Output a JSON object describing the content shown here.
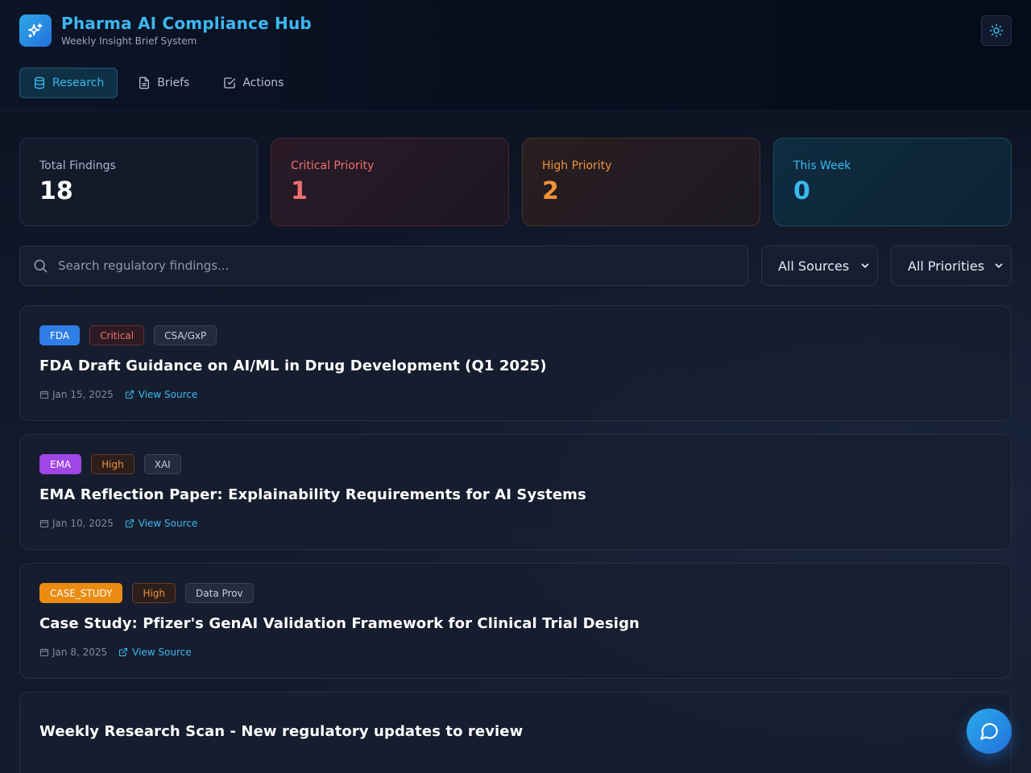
{
  "header": {
    "title": "Pharma AI Compliance Hub",
    "subtitle": "Weekly Insight Brief System",
    "logo_icon": "sparkles-icon",
    "theme_icon": "sun-icon"
  },
  "nav": {
    "items": [
      {
        "label": "Research",
        "icon": "database-icon",
        "active": true
      },
      {
        "label": "Briefs",
        "icon": "document-icon",
        "active": false
      },
      {
        "label": "Actions",
        "icon": "checkbox-icon",
        "active": false
      }
    ]
  },
  "stats": [
    {
      "label": "Total Findings",
      "value": "18"
    },
    {
      "label": "Critical Priority",
      "value": "1"
    },
    {
      "label": "High Priority",
      "value": "2"
    },
    {
      "label": "This Week",
      "value": "0"
    }
  ],
  "filters": {
    "search_placeholder": "Search regulatory findings...",
    "search_value": "",
    "source_selected": "All Sources",
    "priority_selected": "All Priorities"
  },
  "findings": [
    {
      "source": "FDA",
      "priority": "Critical",
      "category": "CSA/GxP",
      "title": "FDA Draft Guidance on AI/ML in Drug Development (Q1 2025)",
      "date": "Jan 15, 2025",
      "link_label": "View Source"
    },
    {
      "source": "EMA",
      "priority": "High",
      "category": "XAI",
      "title": "EMA Reflection Paper: Explainability Requirements for AI Systems",
      "date": "Jan 10, 2025",
      "link_label": "View Source"
    },
    {
      "source": "CASE_STUDY",
      "priority": "High",
      "category": "Data Prov",
      "title": "Case Study: Pfizer's GenAI Validation Framework for Clinical Trial Design",
      "date": "Jan 8, 2025",
      "link_label": "View Source"
    }
  ],
  "scan_card": {
    "title": "Weekly Research Scan - New regulatory updates to review"
  },
  "colors": {
    "accent": "#3ab9ee",
    "critical": "#f0706d",
    "high": "#f2913a",
    "fda": "#2f7ee6",
    "ema": "#a045e6",
    "case_study": "#ea8b12"
  },
  "fab_icon": "chat-bubble-icon"
}
